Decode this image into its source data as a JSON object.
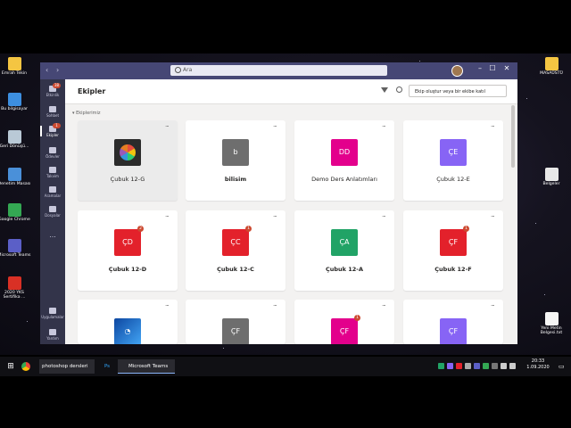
{
  "desktop": {
    "icons_left": [
      {
        "label": "Emrah Tekin",
        "color": "#f4c542"
      },
      {
        "label": "Bu bilgisayar",
        "color": "#3d8fe0"
      },
      {
        "label": "Geri Dönüşü...",
        "color": "#b9c9d6"
      },
      {
        "label": "Denetim Masası",
        "color": "#4a90d9"
      },
      {
        "label": "Google Chrome",
        "color": "#34a853"
      },
      {
        "label": "Microsoft Teams",
        "color": "#5b5fc7"
      },
      {
        "label": "2020 YKS Sertifika ...",
        "color": "#d93025"
      }
    ],
    "icons_right": [
      {
        "label": "MASAÜSTÜ",
        "color": "#f4c542"
      },
      {
        "label": "Belgeler",
        "color": "#e8e8e8"
      },
      {
        "label": "Yeni Metin Belgesi.txt",
        "color": "#f5f5f5"
      }
    ]
  },
  "teams": {
    "search_placeholder": "Ara",
    "window_controls": {
      "minimize": "–",
      "maximize": "☐",
      "close": "✕"
    },
    "rail": [
      {
        "label": "Etkinlik",
        "badge": "38"
      },
      {
        "label": "Sohbet",
        "badge": ""
      },
      {
        "label": "Ekipler",
        "badge": "1"
      },
      {
        "label": "Ödevler",
        "badge": ""
      },
      {
        "label": "Takvim",
        "badge": ""
      },
      {
        "label": "Aramalar",
        "badge": ""
      },
      {
        "label": "Dosyalar",
        "badge": ""
      },
      {
        "label": "...",
        "badge": ""
      },
      {
        "label": "Uygulamalar",
        "badge": ""
      },
      {
        "label": "Yardım",
        "badge": ""
      }
    ],
    "page_title": "Ekipler",
    "join_button": "Ekip oluştur veya bir ekibe katıl",
    "section_label": "Ekiplerimiz",
    "more": "···",
    "teams": [
      {
        "name": "Çubuk 12-G",
        "tile": "",
        "color": "#2b2b2b",
        "bold": false,
        "badge": ""
      },
      {
        "name": "bilisim",
        "tile": "b",
        "color": "#6e6e6e",
        "bold": true,
        "badge": ""
      },
      {
        "name": "Demo Ders Anlatımları",
        "tile": "DD",
        "color": "#e3008c",
        "bold": false,
        "badge": ""
      },
      {
        "name": "Çubuk 12-E",
        "tile": "ÇE",
        "color": "#8764f5",
        "bold": false,
        "badge": ""
      },
      {
        "name": "Çubuk 12-D",
        "tile": "ÇD",
        "color": "#e3212b",
        "bold": true,
        "badge": "2"
      },
      {
        "name": "Çubuk 12-C",
        "tile": "ÇC",
        "color": "#e3212b",
        "bold": true,
        "badge": "1"
      },
      {
        "name": "Çubuk 12-A",
        "tile": "ÇA",
        "color": "#21a366",
        "bold": true,
        "badge": ""
      },
      {
        "name": "Çubuk 12-F",
        "tile": "ÇF",
        "color": "#e3212b",
        "bold": true,
        "badge": "1"
      },
      {
        "name": "",
        "tile": "",
        "color": "#1565c0",
        "bold": false,
        "badge": ""
      },
      {
        "name": "",
        "tile": "ÇF",
        "color": "#6e6e6e",
        "bold": false,
        "badge": ""
      },
      {
        "name": "",
        "tile": "ÇF",
        "color": "#e3008c",
        "bold": false,
        "badge": "1"
      },
      {
        "name": "",
        "tile": "ÇF",
        "color": "#8764f5",
        "bold": false,
        "badge": ""
      }
    ]
  },
  "taskbar": {
    "items": [
      {
        "label": "photoshop dersleri"
      },
      {
        "label": "Ps"
      },
      {
        "label": "Microsoft Teams"
      }
    ],
    "time": "20:33",
    "date": "1.09.2020"
  }
}
